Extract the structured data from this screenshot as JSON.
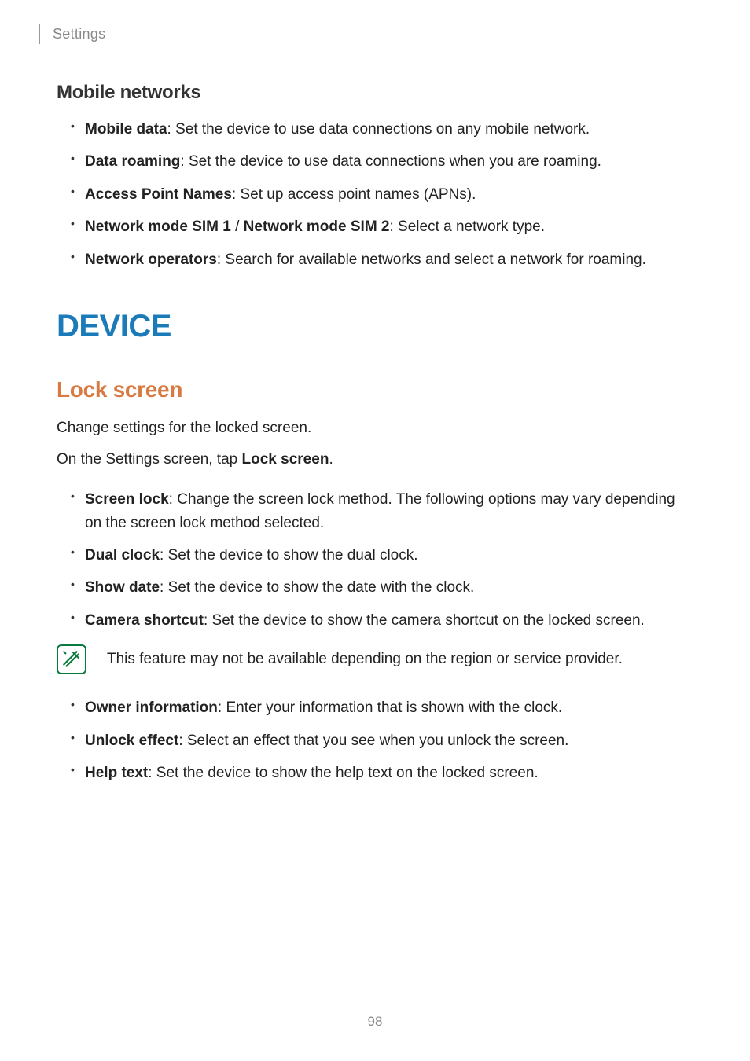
{
  "header": {
    "title": "Settings"
  },
  "section1": {
    "title": "Mobile networks",
    "items": [
      {
        "label": "Mobile data",
        "desc": ": Set the device to use data connections on any mobile network."
      },
      {
        "label": "Data roaming",
        "desc": ": Set the device to use data connections when you are roaming."
      },
      {
        "label": "Access Point Names",
        "desc": ": Set up access point names (APNs)."
      },
      {
        "label": "Network mode SIM 1",
        "label2": "Network mode SIM 2",
        "separator": " / ",
        "desc": ": Select a network type."
      },
      {
        "label": "Network operators",
        "desc": ": Search for available networks and select a network for roaming."
      }
    ]
  },
  "mainHeading": "DEVICE",
  "section2": {
    "title": "Lock screen",
    "intro1": "Change settings for the locked screen.",
    "intro2_prefix": "On the Settings screen, tap ",
    "intro2_bold": "Lock screen",
    "intro2_suffix": ".",
    "items1": [
      {
        "label": "Screen lock",
        "desc": ": Change the screen lock method. The following options may vary depending on the screen lock method selected."
      },
      {
        "label": "Dual clock",
        "desc": ": Set the device to show the dual clock."
      },
      {
        "label": "Show date",
        "desc": ": Set the device to show the date with the clock."
      },
      {
        "label": "Camera shortcut",
        "desc": ": Set the device to show the camera shortcut on the locked screen."
      }
    ],
    "note": "This feature may not be available depending on the region or service provider.",
    "items2": [
      {
        "label": "Owner information",
        "desc": ": Enter your information that is shown with the clock."
      },
      {
        "label": "Unlock effect",
        "desc": ": Select an effect that you see when you unlock the screen."
      },
      {
        "label": "Help text",
        "desc": ": Set the device to show the help text on the locked screen."
      }
    ]
  },
  "pageNumber": "98"
}
